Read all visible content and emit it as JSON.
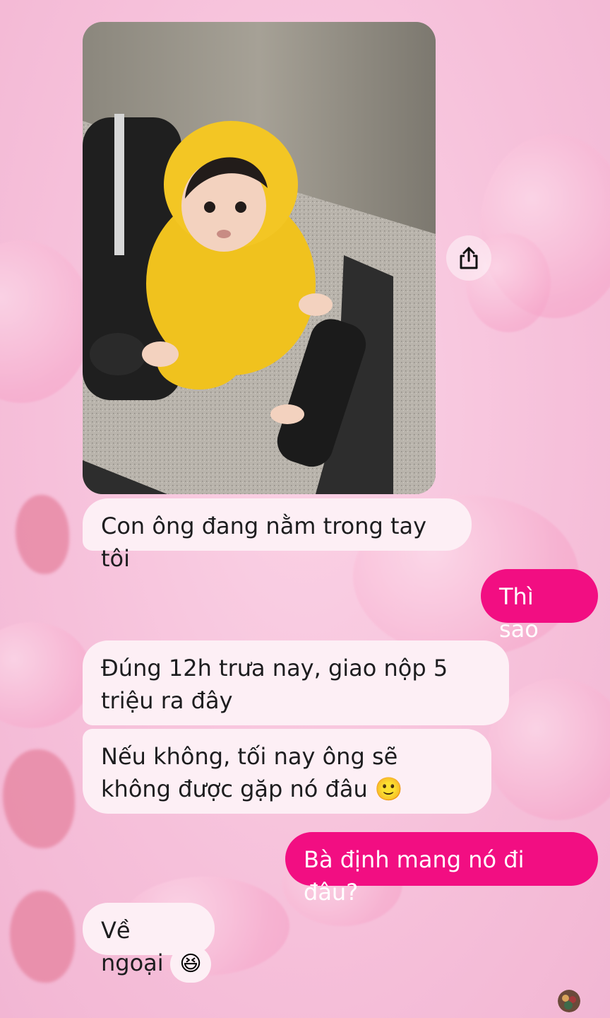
{
  "messages": {
    "received_1": "Con ông đang nằm trong tay tôi",
    "sent_1": "Thì sao",
    "received_2": "Đúng 12h trưa nay, giao nộp 5 triệu ra đây",
    "received_3": "Nếu không, tối nay ông sẽ không được gặp nó đâu 🙂",
    "sent_2": "Bà định mang nó đi đâu?",
    "received_4": "Về ngoại"
  },
  "reaction": {
    "emoji": "😆",
    "icon": "laughing-face-icon"
  },
  "photo": {
    "icon": "photo-attachment"
  },
  "share": {
    "icon": "share-icon"
  },
  "colors": {
    "sent_bubble": "#f20e82",
    "received_bubble": "#fdeff5",
    "background": "#f7c4dc"
  }
}
